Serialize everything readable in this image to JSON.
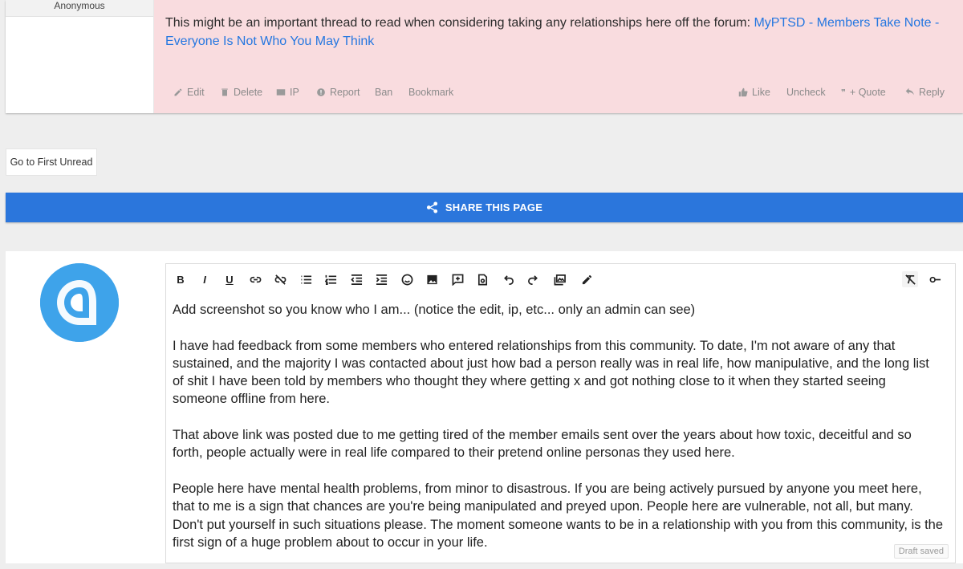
{
  "post": {
    "author": "Anonymous",
    "text": "This might be an important thread to read when considering taking any relationships here off the forum: ",
    "link_text": "MyPTSD - Members Take Note - Everyone Is Not Who You May Think",
    "actions_left": {
      "edit": "Edit",
      "delete": "Delete",
      "ip": "IP",
      "report": "Report",
      "ban": "Ban",
      "bookmark": "Bookmark"
    },
    "actions_right": {
      "like": "Like",
      "uncheck": "Uncheck",
      "quote": "+ Quote",
      "reply": "Reply"
    }
  },
  "go_to_first_unread": "Go to First Unread",
  "share_bar": {
    "label": "SHARE THIS PAGE"
  },
  "editor": {
    "paragraphs": [
      "Add screenshot so you know who I am... (notice the edit, ip, etc... only an admin can see)",
      "I have had feedback from some members who entered relationships from this community. To date, I'm not aware of any that sustained, and the majority I was contacted about just how bad a person really was in real life, how manipulative, and the long list of shit I have been told by members who thought they where getting x and got nothing close to it when they started seeing someone offline from here.",
      "That above link was posted due to me getting tired of the member emails sent over the years about how toxic, deceitful and so forth, people actually were in real life compared to their pretend online personas they used here.",
      "People here have mental health problems, from minor to disastrous. If you are being actively pursued by anyone you meet here, that to me is a sign that chances are you're being manipulated and preyed upon. People here are vulnerable, not all, but many. Don't put yourself in such situations please. The moment someone wants to be in a relationship with you from this community, is the first sign of a huge problem about to occur in your life."
    ],
    "draft_status": "Draft saved",
    "toolbar_bold": "B",
    "toolbar_italic": "I",
    "toolbar_underline": "U"
  },
  "colors": {
    "post_bg": "#f9dcdf",
    "link": "#2577e0",
    "share_bar": "#2b76dc",
    "avatar": "#3ea3ea"
  }
}
